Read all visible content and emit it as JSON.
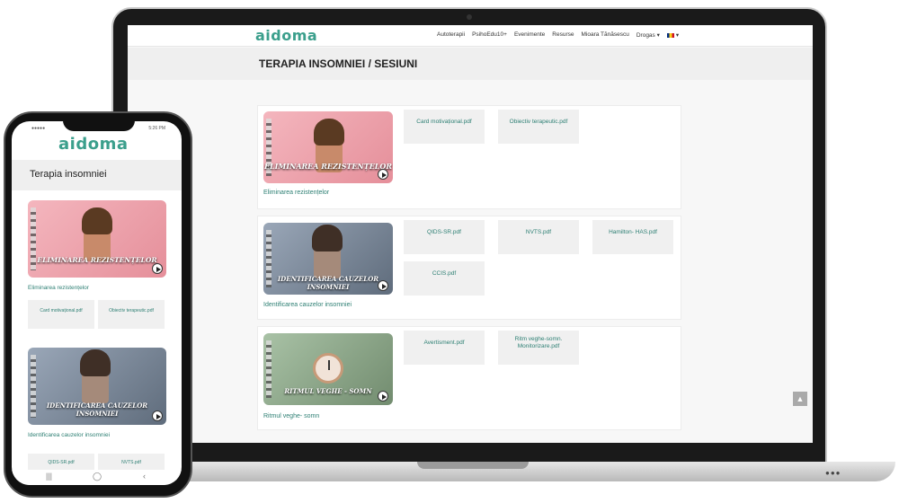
{
  "site": {
    "logo": "aidoma",
    "nav": [
      "Autoterapii",
      "PsihoEdu10+",
      "Evenimente",
      "Resurse",
      "Mioara Tănăsescu",
      "Drogas ▾"
    ],
    "lang_caret": "▾",
    "page_title": "TERAPIA INSOMNIEI / SESIUNI"
  },
  "sessions": [
    {
      "caption": "ELIMINAREA REZISTENȚELOR",
      "label": "Eliminarea rezistențelor",
      "pdfs": [
        "Card motivațional.pdf",
        "Obiectiv terapeutic.pdf"
      ]
    },
    {
      "caption": "IDENTIFICAREA CAUZELOR INSOMNIEI",
      "label": "Identificarea cauzelor insomniei",
      "pdfs": [
        "QIDS-SR.pdf",
        "NVTS.pdf",
        "Hamilton- HAS.pdf",
        "CCIS.pdf"
      ]
    },
    {
      "caption": "RITMUL VEGHE - SOMN",
      "label": "Ritmul veghe- somn",
      "pdfs": [
        "Avertisment.pdf",
        "Ritm veghe-somn. Monitorizare.pdf"
      ]
    }
  ],
  "scroll_top": "▲",
  "phone": {
    "status_left": "●●●●●",
    "status_right": "5:26 PM",
    "logo": "aidoma",
    "title": "Terapia insomniei",
    "session1_caption": "ELIMINAREA REZISTENȚELOR",
    "session1_label": "Eliminarea rezistențelor",
    "session1_pdfs": [
      "Card motivațional.pdf",
      "Obiectiv terapeutic.pdf"
    ],
    "session2_caption": "IDENTIFICAREA CAUZELOR INSOMNIEI",
    "session2_label": "Identificarea cauzelor insomniei",
    "session2_pdfs": [
      "QIDS-SR.pdf",
      "NVTS.pdf"
    ],
    "nav": [
      "|||",
      "◯",
      "‹"
    ]
  },
  "colors": {
    "brand": "#3b9f8c",
    "link": "#2d7f73"
  }
}
